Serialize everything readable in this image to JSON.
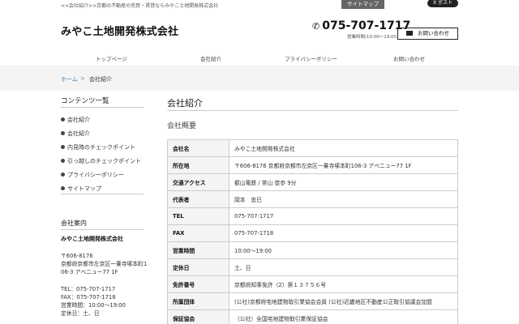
{
  "topbar": {
    "breadcrumb": "<<会社紹介>>京都の不動産の売買・賃貸ならみやこ土地開発株式会社",
    "sitemap_label": "サイトマップ",
    "post_label": "X ポスト"
  },
  "header": {
    "title": "みやこ土地開発株式会社",
    "phone": "075-707-1717",
    "hours": "営業時間/10:00〜19:00",
    "contact_label": "お問い合わせ"
  },
  "nav": {
    "items": [
      "トップページ",
      "会社紹介",
      "プライバシーポリシー",
      "お問い合わせ"
    ]
  },
  "crumb": {
    "home": "ホーム",
    "sep": ">",
    "current": "会社紹介"
  },
  "sidebar": {
    "title": "コンテンツ一覧",
    "items": [
      "会社紹介",
      "会社紹介",
      "内見時のチェックポイント",
      "引っ越しのチェックポイント",
      "プライバシーポリシー",
      "サイトマップ"
    ],
    "info_title": "会社案内",
    "company": "みやこ土地開発株式会社",
    "address_lines": [
      "〒606-8176",
      "京都府京都市左京区一乗寺塚本町1",
      "06-3 アベニュー77 1F"
    ],
    "contact_lines": [
      "TEL：075-707-1717",
      "FAX：075-707-1718",
      "営業時間：10:00〜19:00",
      "定休日：土、日"
    ]
  },
  "main": {
    "title": "会社紹介",
    "section": "会社概要",
    "rows": [
      {
        "label": "会社名",
        "value": "みやこ土地開発株式会社"
      },
      {
        "label": "所在地",
        "value": "〒606-8176 京都府京都市左京区一乗寺塚本町106-3 アベニュー77 1F"
      },
      {
        "label": "交通アクセス",
        "value": "叡山電鉄 / 茶山 徒歩 9分"
      },
      {
        "label": "代表者",
        "value": "岡本　忠巳"
      },
      {
        "label": "TEL",
        "value": "075-707-1717"
      },
      {
        "label": "FAX",
        "value": "075-707-1718"
      },
      {
        "label": "営業時間",
        "value": "10:00〜19:00"
      },
      {
        "label": "定休日",
        "value": "土、日"
      },
      {
        "label": "免許番号",
        "value": "京都府知事免許（2）第１３７５６号"
      },
      {
        "label": "所属団体",
        "value": "(公社)京都府宅地建物取引業協会会員 (公社)近畿地区不動産公正取引協議会加盟"
      },
      {
        "label": "保証協会",
        "value": "（公社）全国宅地建物取引業保証協会"
      }
    ]
  },
  "colors": {
    "link": "#3b7fb5",
    "dark": "#222222",
    "table_head_bg": "#f4f4f4"
  }
}
